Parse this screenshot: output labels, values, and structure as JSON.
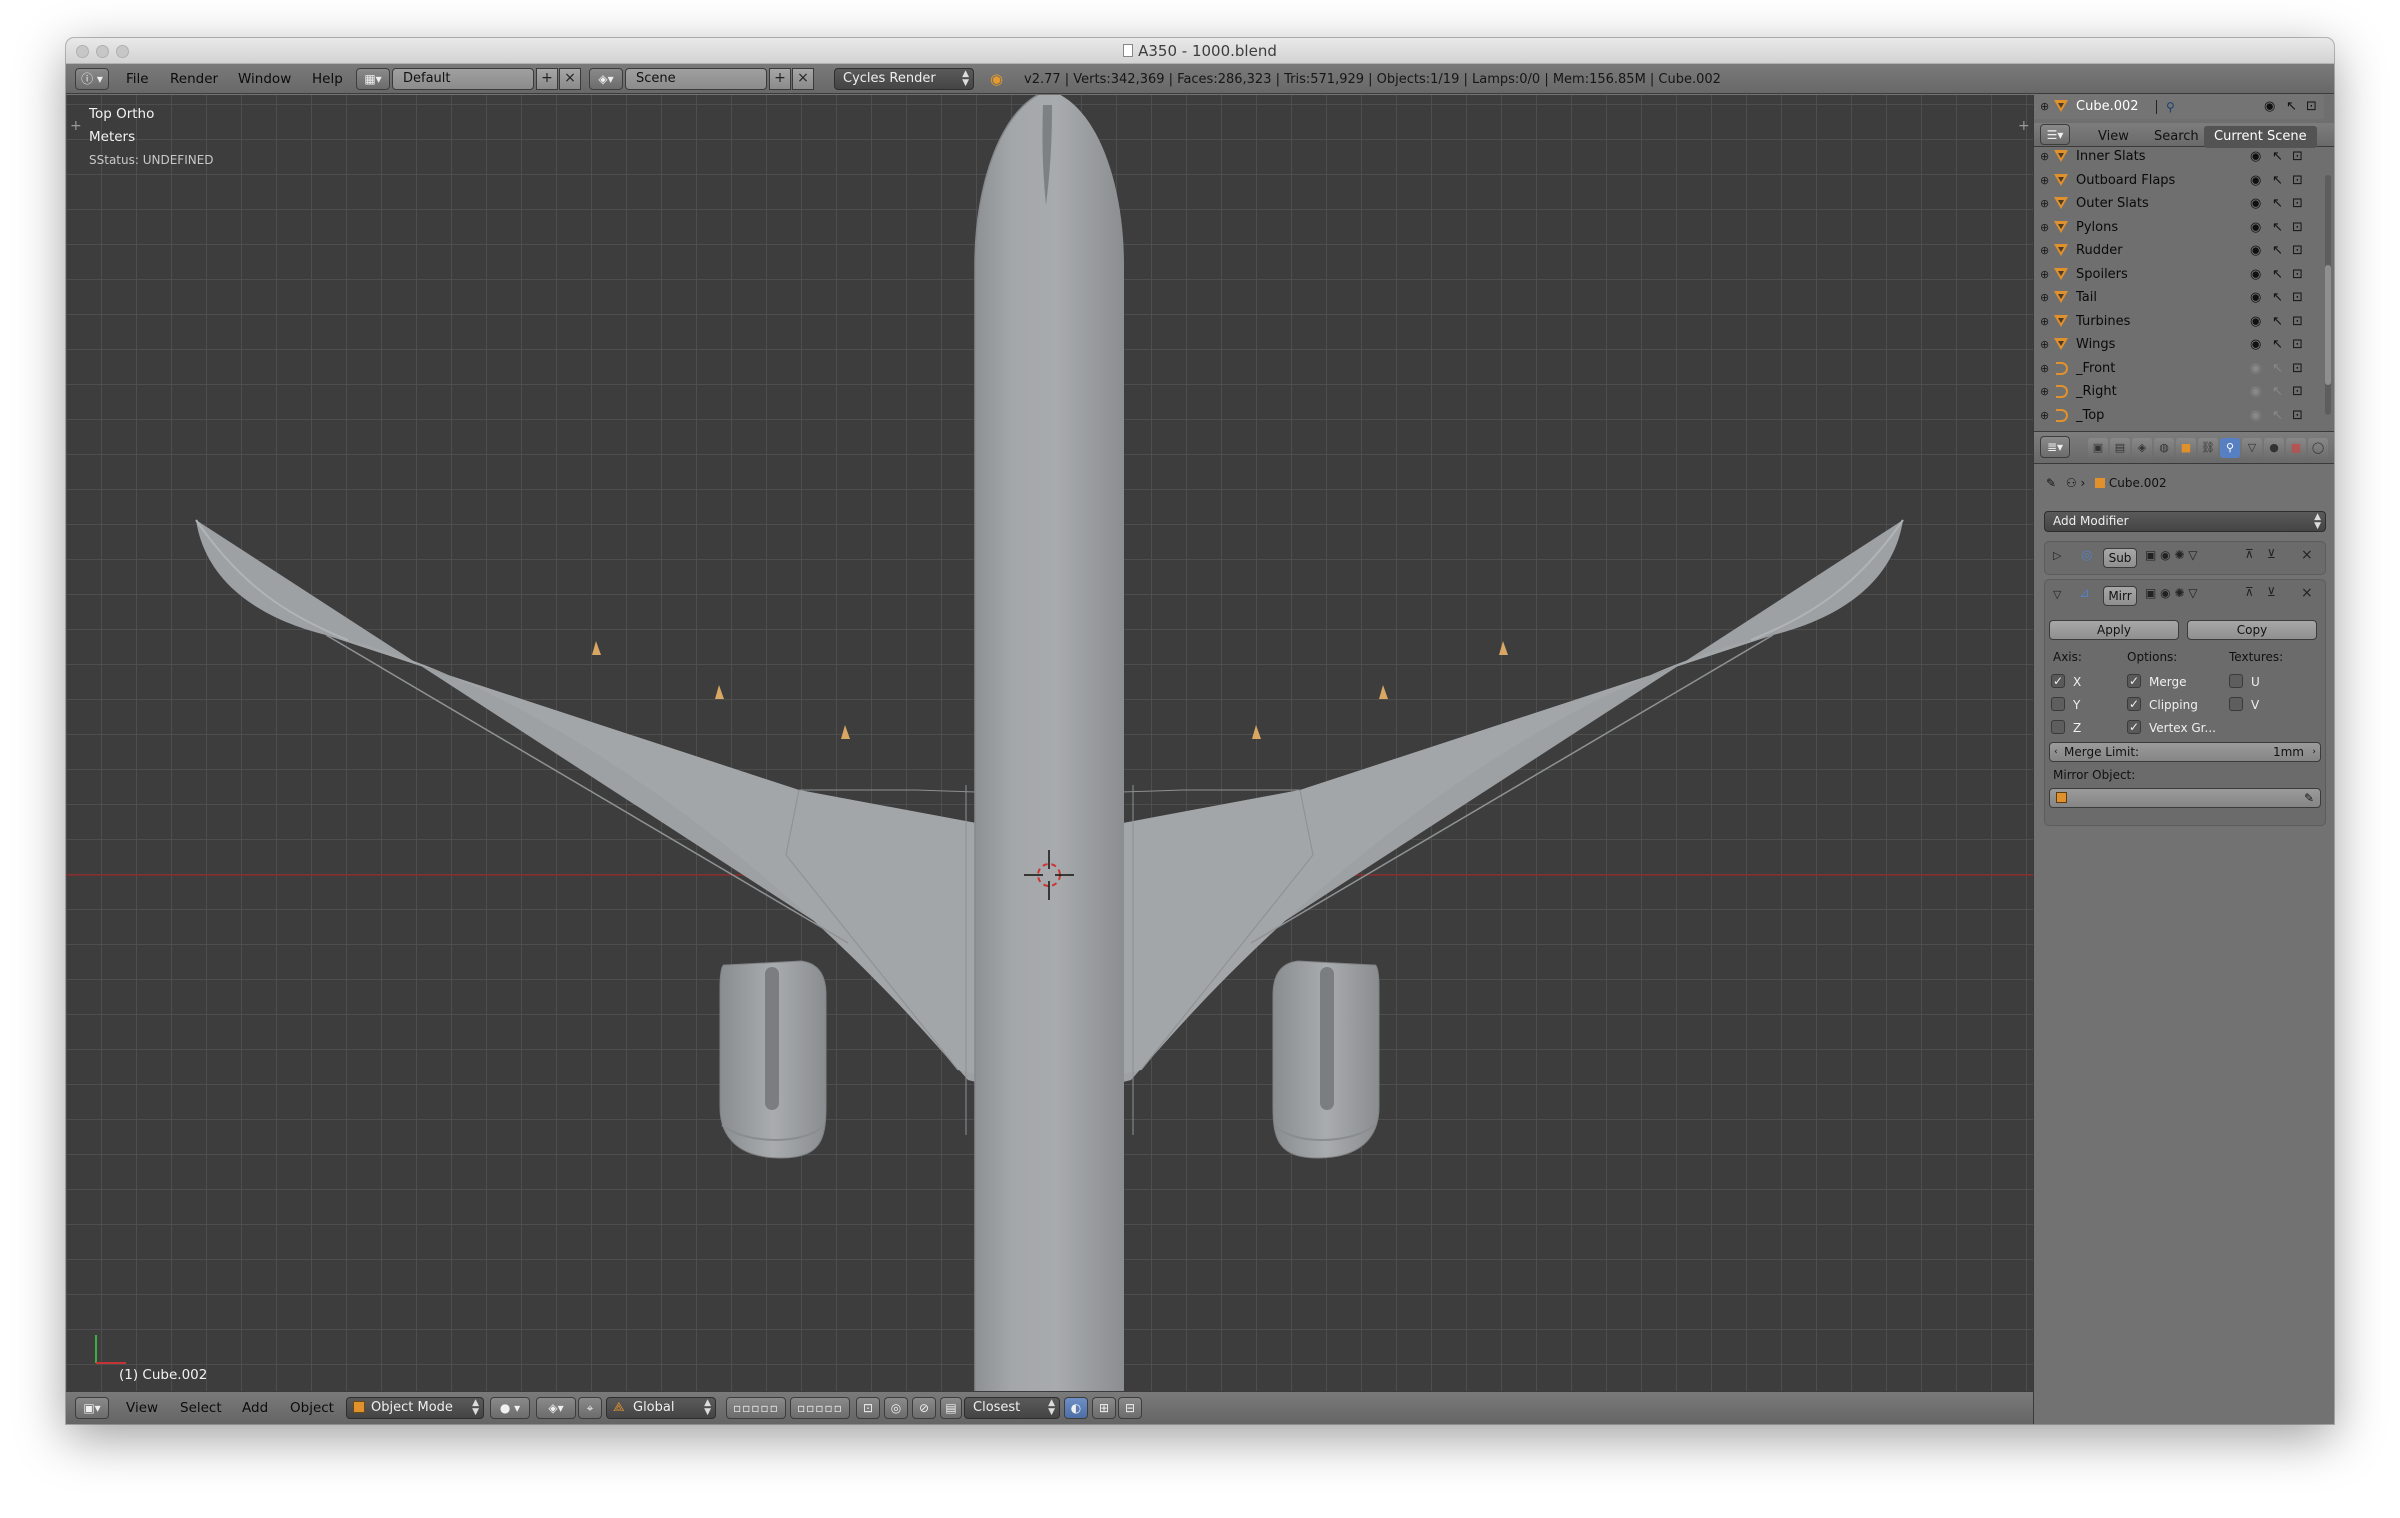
{
  "window": {
    "title": "A350 - 1000.blend"
  },
  "top_menu": [
    "File",
    "Render",
    "Window",
    "Help"
  ],
  "layout_field": "Default",
  "scene_field": "Scene",
  "render_engine": "Cycles Render",
  "stats": "v2.77 | Verts:342,369 | Faces:286,323 | Tris:571,929 | Objects:1/19 | Lamps:0/0 | Mem:156.85M | Cube.002",
  "viewport": {
    "view_name": "Top Ortho",
    "units": "Meters",
    "status": "SStatus: UNDEFINED",
    "active_object": "(1) Cube.002"
  },
  "bottom_menu": [
    "View",
    "Select",
    "Add",
    "Object"
  ],
  "mode_dropdown": "Object Mode",
  "orientation_dropdown": "Global",
  "snap_dropdown": "Closest",
  "outliner": {
    "header_object": "Cube.002",
    "tabs": [
      "View",
      "Search",
      "Current Scene"
    ],
    "rows": [
      {
        "label": "Inner Slats",
        "icon": "mesh-triangle-icon",
        "restrict": true
      },
      {
        "label": "Outboard Flaps",
        "icon": "mesh-triangle-icon",
        "restrict": true
      },
      {
        "label": "Outer Slats",
        "icon": "mesh-triangle-icon",
        "restrict": true
      },
      {
        "label": "Pylons",
        "icon": "mesh-triangle-icon",
        "restrict": true
      },
      {
        "label": "Rudder",
        "icon": "mesh-triangle-icon",
        "restrict": true
      },
      {
        "label": "Spoilers",
        "icon": "mesh-triangle-icon",
        "restrict": true
      },
      {
        "label": "Tail",
        "icon": "mesh-triangle-icon",
        "restrict": true
      },
      {
        "label": "Turbines",
        "icon": "mesh-triangle-icon",
        "restrict": true
      },
      {
        "label": "Wings",
        "icon": "mesh-triangle-icon",
        "restrict": true
      },
      {
        "label": "_Front",
        "icon": "camera-icon",
        "restrict": false
      },
      {
        "label": "_Right",
        "icon": "camera-icon",
        "restrict": false
      },
      {
        "label": "_Top",
        "icon": "camera-icon",
        "restrict": false
      }
    ]
  },
  "properties": {
    "breadcrumb_object": "Cube.002",
    "add_modifier": "Add Modifier",
    "modifier1_name": "Sub",
    "modifier2_name": "Mirr",
    "apply_label": "Apply",
    "copy_label": "Copy",
    "axis_header": "Axis:",
    "options_header": "Options:",
    "textures_header": "Textures:",
    "axis": [
      {
        "label": "X",
        "checked": true
      },
      {
        "label": "Y",
        "checked": false
      },
      {
        "label": "Z",
        "checked": false
      }
    ],
    "options": [
      {
        "label": "Merge",
        "checked": true
      },
      {
        "label": "Clipping",
        "checked": true
      },
      {
        "label": "Vertex Gr...",
        "checked": true
      }
    ],
    "textures": [
      {
        "label": "U",
        "checked": false
      },
      {
        "label": "V",
        "checked": false
      }
    ],
    "merge_limit_label": "Merge Limit:",
    "merge_limit_value": "1mm",
    "mirror_object_label": "Mirror Object:"
  },
  "colors": {
    "viewport_bg": "#3d3d3d",
    "aircraft": "#9ea1a3",
    "x_axis": "#8a2a2a",
    "accent": "#5680c2",
    "mesh_icon": "#e0912c"
  }
}
